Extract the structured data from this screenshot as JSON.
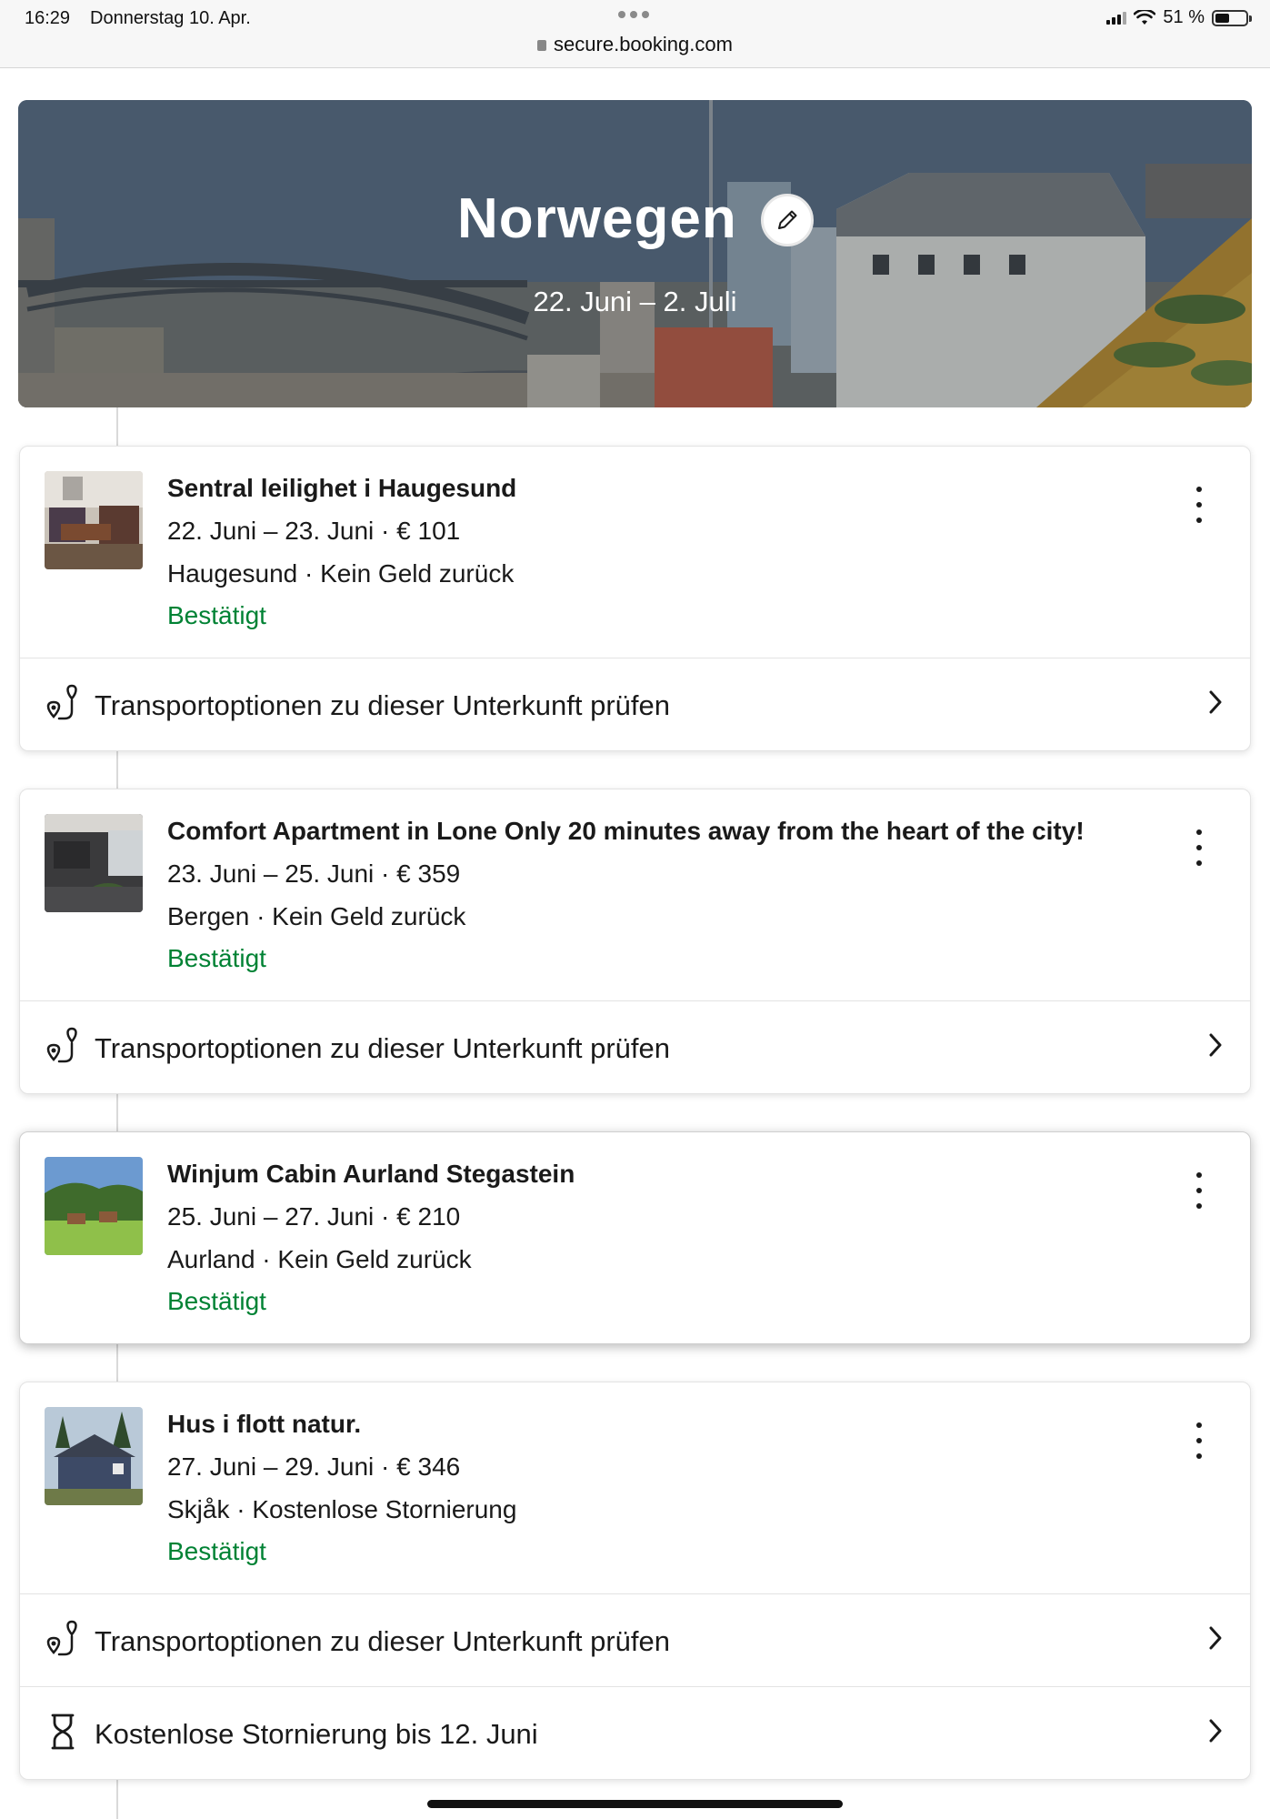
{
  "status_bar": {
    "time": "16:29",
    "date": "Donnerstag 10. Apr.",
    "url": "secure.booking.com",
    "battery": "51 %",
    "battery_level": 0.51
  },
  "trip": {
    "title": "Norwegen",
    "dates": "22. Juni – 2. Juli"
  },
  "colors": {
    "confirmed": "#008234",
    "text": "#1a1a1a"
  },
  "icons": {
    "edit": "pencil-icon",
    "menu": "more-vertical-icon",
    "transport": "route-pin-icon",
    "cancellation": "hourglass-icon",
    "chevron": "chevron-right-icon"
  },
  "bookings": [
    {
      "title": "Sentral leilighet i Haugesund",
      "dates_price": "22. Juni – 23. Juni · € 101",
      "location_policy": "Haugesund · Kein Geld zurück",
      "status": "Bestätigt",
      "transport": "Transportoptionen zu dieser Unterkunft prüfen"
    },
    {
      "title": "Comfort Apartment in Lone Only 20 minutes away from the heart of the city!",
      "dates_price": "23. Juni – 25. Juni · € 359",
      "location_policy": "Bergen · Kein Geld zurück",
      "status": "Bestätigt",
      "transport": "Transportoptionen zu dieser Unterkunft prüfen"
    },
    {
      "title": "Winjum Cabin Aurland Stegastein",
      "dates_price": "25. Juni – 27. Juni · € 210",
      "location_policy": "Aurland · Kein Geld zurück",
      "status": "Bestätigt"
    },
    {
      "title": "Hus i flott natur.",
      "dates_price": "27. Juni – 29. Juni · € 346",
      "location_policy": "Skjåk · Kostenlose Stornierung",
      "status": "Bestätigt",
      "transport": "Transportoptionen zu dieser Unterkunft prüfen",
      "cancellation": "Kostenlose Stornierung bis 12. Juni"
    }
  ]
}
